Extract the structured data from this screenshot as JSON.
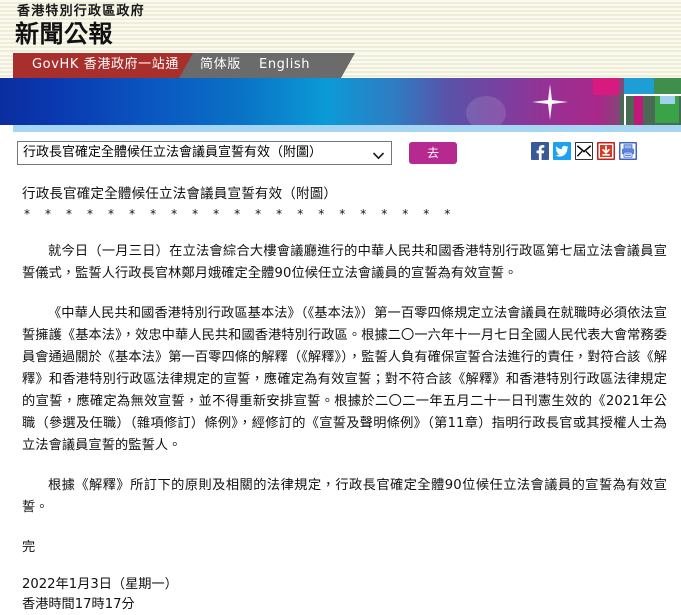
{
  "header": {
    "gov_line": "香港特別行政區政府",
    "title": "新聞公報"
  },
  "tabs": [
    {
      "id": "govhk",
      "label": "GovHK 香港政府一站通"
    },
    {
      "id": "simplified",
      "label": "简体版"
    },
    {
      "id": "english",
      "label": "English"
    }
  ],
  "colors": {
    "tab_active": "#a82f2c",
    "tab_inactive": "#6b6b6b",
    "go_button": "#b62a8f",
    "header_bg": "#f7f6e8",
    "banner_underline": "#a6d5f2"
  },
  "toolbar": {
    "select_value": "行政長官確定全體候任立法會議員宣誓有效（附圖）",
    "select_chevron": "⌄",
    "go_label": "去",
    "social_icons": [
      {
        "name": "facebook-icon",
        "title": "Facebook"
      },
      {
        "name": "twitter-icon",
        "title": "Twitter"
      },
      {
        "name": "email-icon",
        "title": "Email"
      },
      {
        "name": "download-icon",
        "title": "Download"
      },
      {
        "name": "print-icon",
        "title": "Print"
      }
    ]
  },
  "article": {
    "title": "行政長官確定全體候任立法會議員宣誓有效（附圖）",
    "stars": "* * * * * * * * * * * * * * * * * * * * *",
    "paragraphs": [
      "就今日（一月三日）在立法會綜合大樓會議廳進行的中華人民共和國香港特別行政區第七屆立法會議員宣誓儀式，監誓人行政長官林鄭月娥確定全體90位候任立法會議員的宣誓為有效宣誓。",
      "《中華人民共和國香港特別行政區基本法》（《基本法》）第一百零四條規定立法會議員在就職時必須依法宣誓擁護《基本法》，效忠中華人民共和國香港特別行政區。根據二〇一六年十一月七日全國人民代表大會常務委員會通過關於《基本法》第一百零四條的解釋（《解釋》），監誓人負有確保宣誓合法進行的責任，對符合該《解釋》和香港特別行政區法律規定的宣誓，應確定為有效宣誓；對不符合該《解釋》和香港特別行政區法律規定的宣誓，應確定為無效宣誓，並不得重新安排宣誓。根據於二〇二一年五月二十一日刊憲生效的《2021年公職（參選及任職）（雜項修訂）條例》，經修訂的《宣誓及聲明條例》（第11章）指明行政長官或其授權人士為立法會議員宣誓的監誓人。",
      "根據《解釋》所訂下的原則及相關的法律規定，行政長官確定全體90位候任立法會議員的宣誓為有效宣誓。"
    ],
    "end_mark": "完",
    "date_line": "2022年1月3日（星期一）",
    "time_line": "香港時間17時17分"
  }
}
